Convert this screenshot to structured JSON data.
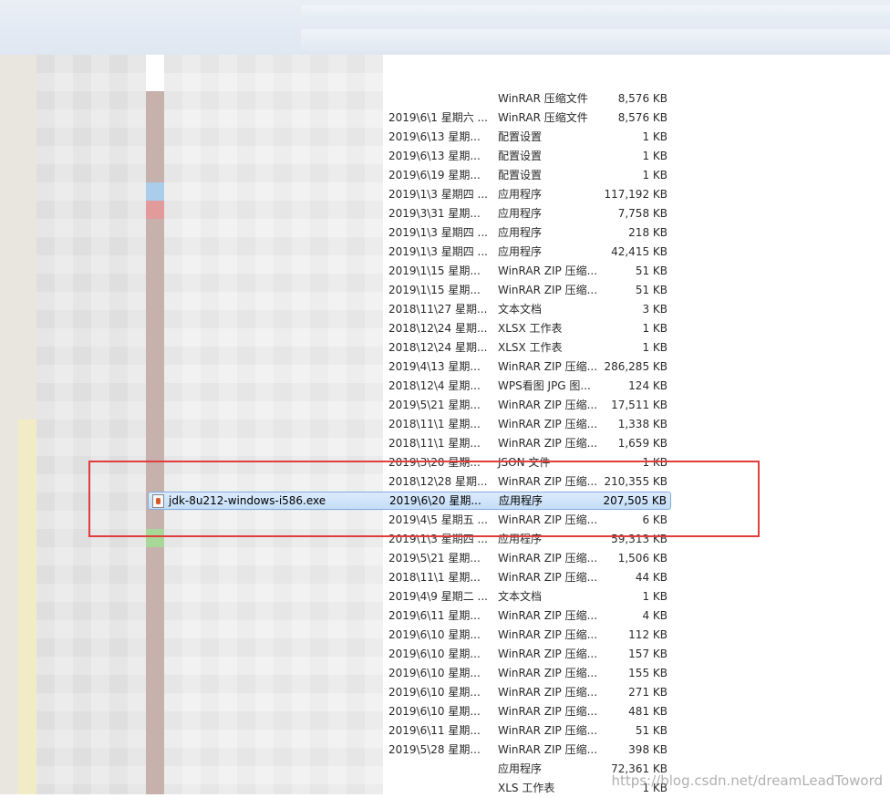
{
  "file_rows": [
    {
      "date": "",
      "type": "WinRAR 压缩文件",
      "size": "8,576 KB"
    },
    {
      "date": "2019\\6\\1 星期六 ...",
      "type": "WinRAR 压缩文件",
      "size": "8,576 KB"
    },
    {
      "date": "2019\\6\\13 星期...",
      "type": "配置设置",
      "size": "1 KB"
    },
    {
      "date": "2019\\6\\13 星期...",
      "type": "配置设置",
      "size": "1 KB"
    },
    {
      "date": "2019\\6\\19 星期...",
      "type": "配置设置",
      "size": "1 KB"
    },
    {
      "date": "2019\\1\\3 星期四 ...",
      "type": "应用程序",
      "size": "117,192 KB"
    },
    {
      "date": "2019\\3\\31 星期...",
      "type": "应用程序",
      "size": "7,758 KB"
    },
    {
      "date": "2019\\1\\3 星期四 ...",
      "type": "应用程序",
      "size": "218 KB"
    },
    {
      "date": "2019\\1\\3 星期四 ...",
      "type": "应用程序",
      "size": "42,415 KB"
    },
    {
      "date": "2019\\1\\15 星期...",
      "type": "WinRAR ZIP 压缩...",
      "size": "51 KB"
    },
    {
      "date": "2019\\1\\15 星期...",
      "type": "WinRAR ZIP 压缩...",
      "size": "51 KB"
    },
    {
      "date": "2018\\11\\27 星期...",
      "type": "文本文档",
      "size": "3 KB"
    },
    {
      "date": "2018\\12\\24 星期...",
      "type": "XLSX 工作表",
      "size": "1 KB"
    },
    {
      "date": "2018\\12\\24 星期...",
      "type": "XLSX 工作表",
      "size": "1 KB"
    },
    {
      "date": "2019\\4\\13 星期...",
      "type": "WinRAR ZIP 压缩...",
      "size": "286,285 KB"
    },
    {
      "date": "2018\\12\\4 星期...",
      "type": "WPS看图 JPG 图...",
      "size": "124 KB"
    },
    {
      "date": "2019\\5\\21 星期...",
      "type": "WinRAR ZIP 压缩...",
      "size": "17,511 KB"
    },
    {
      "date": "2018\\11\\1 星期...",
      "type": "WinRAR ZIP 压缩...",
      "size": "1,338 KB"
    },
    {
      "date": "2018\\11\\1 星期...",
      "type": "WinRAR ZIP 压缩...",
      "size": "1,659 KB"
    },
    {
      "date": "2019\\3\\20 星期...",
      "type": "JSON 文件",
      "size": "1 KB"
    },
    {
      "date": "2018\\12\\28 星期...",
      "type": "WinRAR ZIP 压缩...",
      "size": "210,355 KB"
    },
    {
      "date": "2019\\6\\20 星期...",
      "type": "应用程序",
      "size": "207,505 KB"
    },
    {
      "date": "2019\\4\\5 星期五 ...",
      "type": "WinRAR ZIP 压缩...",
      "size": "6 KB"
    },
    {
      "date": "2019\\1\\3 星期四 ...",
      "type": "应用程序",
      "size": "59,313 KB"
    },
    {
      "date": "2019\\5\\21 星期...",
      "type": "WinRAR ZIP 压缩...",
      "size": "1,506 KB"
    },
    {
      "date": "2018\\11\\1 星期...",
      "type": "WinRAR ZIP 压缩...",
      "size": "44 KB"
    },
    {
      "date": "2019\\4\\9 星期二 ...",
      "type": "文本文档",
      "size": "1 KB"
    },
    {
      "date": "2019\\6\\11 星期...",
      "type": "WinRAR ZIP 压缩...",
      "size": "4 KB"
    },
    {
      "date": "2019\\6\\10 星期...",
      "type": "WinRAR ZIP 压缩...",
      "size": "112 KB"
    },
    {
      "date": "2019\\6\\10 星期...",
      "type": "WinRAR ZIP 压缩...",
      "size": "157 KB"
    },
    {
      "date": "2019\\6\\10 星期...",
      "type": "WinRAR ZIP 压缩...",
      "size": "155 KB"
    },
    {
      "date": "2019\\6\\10 星期...",
      "type": "WinRAR ZIP 压缩...",
      "size": "271 KB"
    },
    {
      "date": "2019\\6\\10 星期...",
      "type": "WinRAR ZIP 压缩...",
      "size": "481 KB"
    },
    {
      "date": "2019\\6\\11 星期...",
      "type": "WinRAR ZIP 压缩...",
      "size": "51 KB"
    },
    {
      "date": "2019\\5\\28 星期...",
      "type": "WinRAR ZIP 压缩...",
      "size": "398 KB"
    },
    {
      "date": "",
      "type": "应用程序",
      "size": "72,361 KB"
    },
    {
      "date": "",
      "type": "XLS 工作表",
      "size": "1 KB"
    }
  ],
  "selected_file": {
    "name": "jdk-8u212-windows-i586.exe",
    "icon": "java-exe-icon"
  },
  "colors": {
    "highlight_border": "#e23c3c",
    "selection_fill": "#cfe3fa",
    "selection_border": "#84acdd"
  },
  "watermark": "https://blog.csdn.net/dreamLeadToword"
}
